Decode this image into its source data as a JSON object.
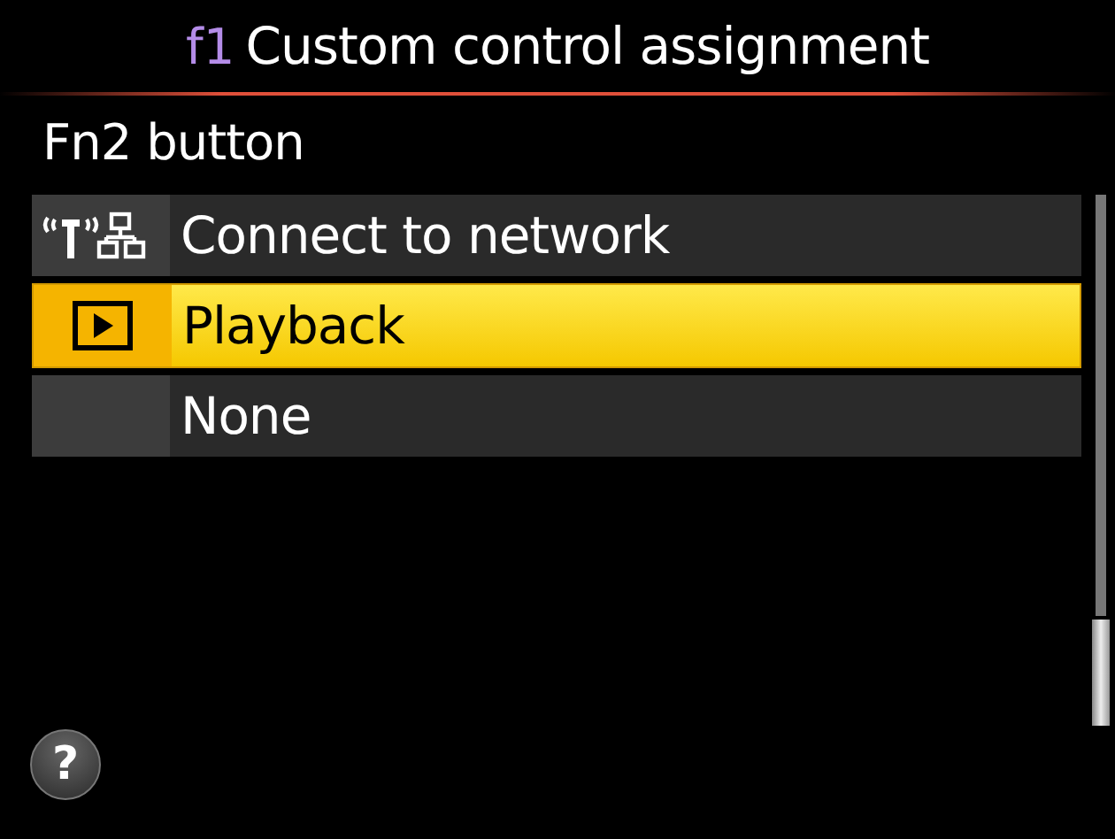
{
  "header": {
    "menu_code": "f1",
    "title": "Custom control assignment"
  },
  "subtitle": "Fn2 button",
  "options": [
    {
      "label": "Connect to network",
      "kind": "network",
      "selected": false
    },
    {
      "label": "Playback",
      "kind": "playback",
      "selected": true
    },
    {
      "label": "None",
      "kind": "none",
      "selected": false
    }
  ],
  "help": {
    "label": "?"
  }
}
